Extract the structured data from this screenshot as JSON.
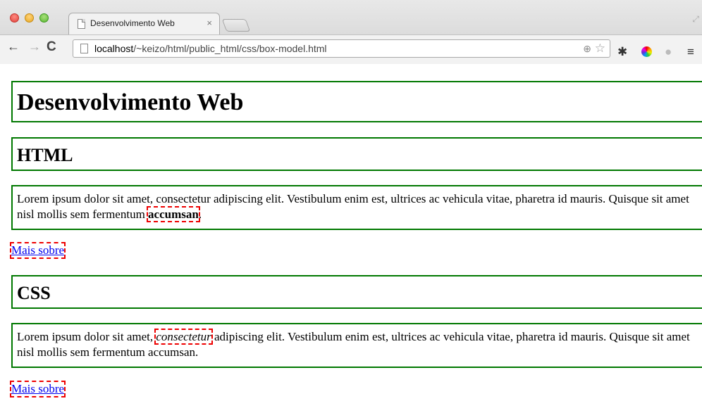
{
  "browser": {
    "tab_title": "Desenvolvimento Web",
    "tab_close": "×",
    "url_host": "localhost",
    "url_path": "/~keizo/html/public_html/css/box-model.html"
  },
  "content": {
    "heading": "Desenvolvimento Web",
    "sections": [
      {
        "title": "HTML",
        "p_before": "Lorem ipsum dolor sit amet, consectetur adipiscing elit. Vestibulum enim est, ultrices ac vehicula vitae, pharetra id mauris. Quisque sit amet nisl mollis sem fermentum ",
        "p_emph": "accumsan",
        "p_after": ".",
        "link": "Mais sobre"
      },
      {
        "title": "CSS",
        "p_before": "Lorem ipsum dolor sit amet, ",
        "p_emph": "consectetur",
        "p_after": " adipiscing elit. Vestibulum enim est, ultrices ac vehicula vitae, pharetra id mauris. Quisque sit amet nisl mollis sem fermentum accumsan.",
        "link": "Mais sobre"
      }
    ]
  }
}
